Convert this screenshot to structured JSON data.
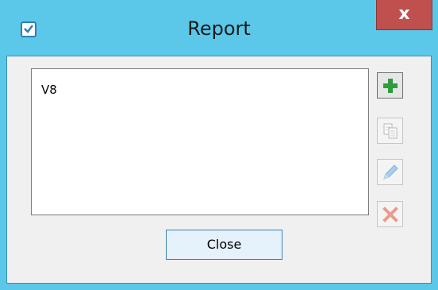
{
  "window": {
    "title": "Report",
    "close_glyph": "x"
  },
  "list": {
    "items": [
      {
        "label": "V8"
      }
    ]
  },
  "toolbar": {
    "add": {
      "icon": "plus-icon",
      "enabled": true
    },
    "copy": {
      "icon": "copy-icon",
      "enabled": false
    },
    "edit": {
      "icon": "pencil-icon",
      "enabled": false
    },
    "delete": {
      "icon": "delete-x-icon",
      "enabled": false
    }
  },
  "footer": {
    "close_label": "Close"
  },
  "colors": {
    "titlebar": "#5bc8ea",
    "close_button": "#c0504d",
    "add_green": "#2e9d3e",
    "delete_red": "#e89c8e",
    "edit_blue": "#7fb5e0"
  }
}
